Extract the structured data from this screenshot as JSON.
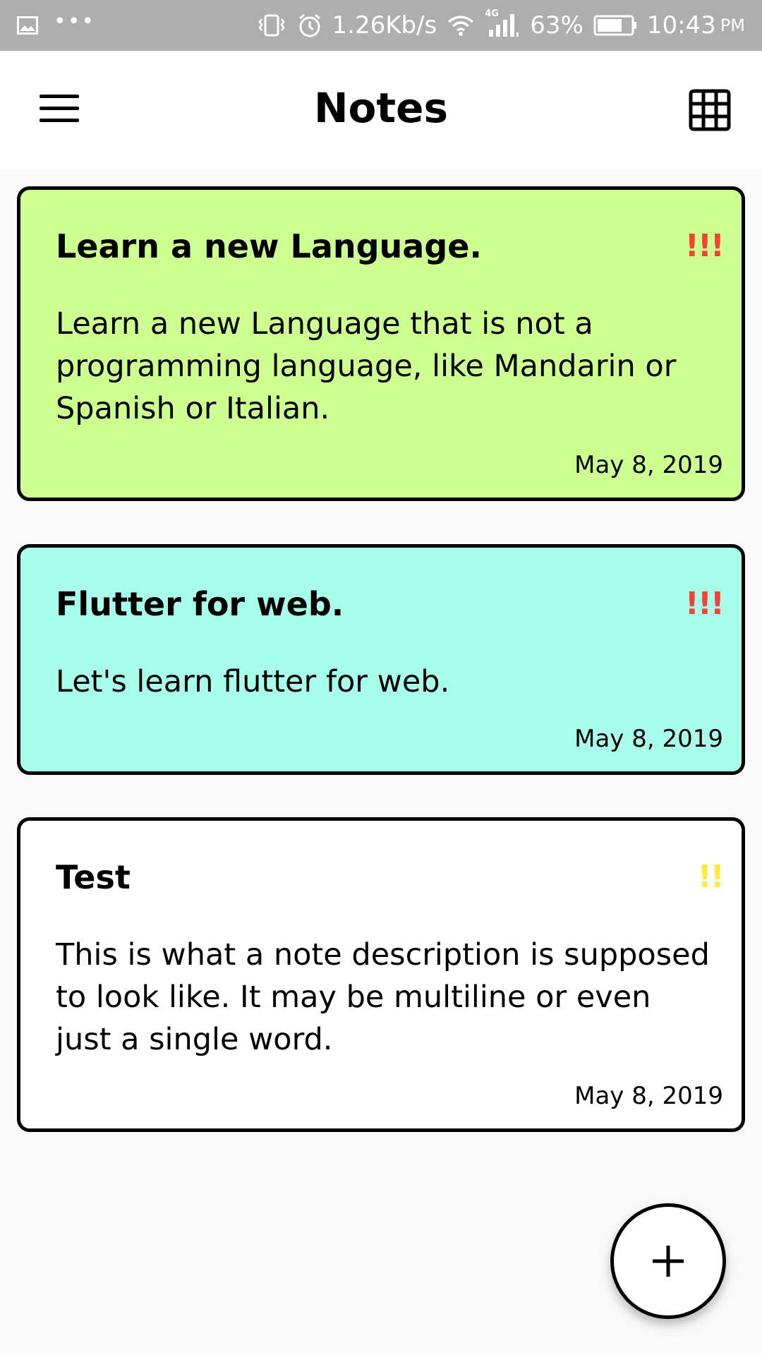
{
  "status_bar": {
    "speed": "1.26Kb/s",
    "network_type": "4G",
    "battery": "63%",
    "time": "10:43",
    "ampm": "PM",
    "icons": [
      "image-icon",
      "more-dots-icon",
      "vibrate-icon",
      "alarm-icon",
      "wifi-icon",
      "signal-icon",
      "battery-icon"
    ]
  },
  "app_bar": {
    "title": "Notes",
    "menu_icon": "hamburger-menu-icon",
    "view_icon": "grid-view-icon"
  },
  "notes": [
    {
      "title": "Learn a new Language.",
      "priority": "!!!",
      "priority_color": "#f44336",
      "description": "Learn a new Language that is not a programming language, like Mandarin or Spanish or Italian.",
      "date": "May 8, 2019",
      "color": "#ccff90"
    },
    {
      "title": "Flutter for web.",
      "priority": "!!!",
      "priority_color": "#f44336",
      "description": "Let's learn flutter for web.",
      "date": "May 8, 2019",
      "color": "#a7ffeb"
    },
    {
      "title": "Test",
      "priority": "!!",
      "priority_color": "#ffeb3b",
      "description": "This is what a note description is supposed to look like. It may be multiline or even just a single word.",
      "date": "May 8, 2019",
      "color": "#ffffff"
    }
  ],
  "fab": {
    "icon": "plus-icon"
  }
}
